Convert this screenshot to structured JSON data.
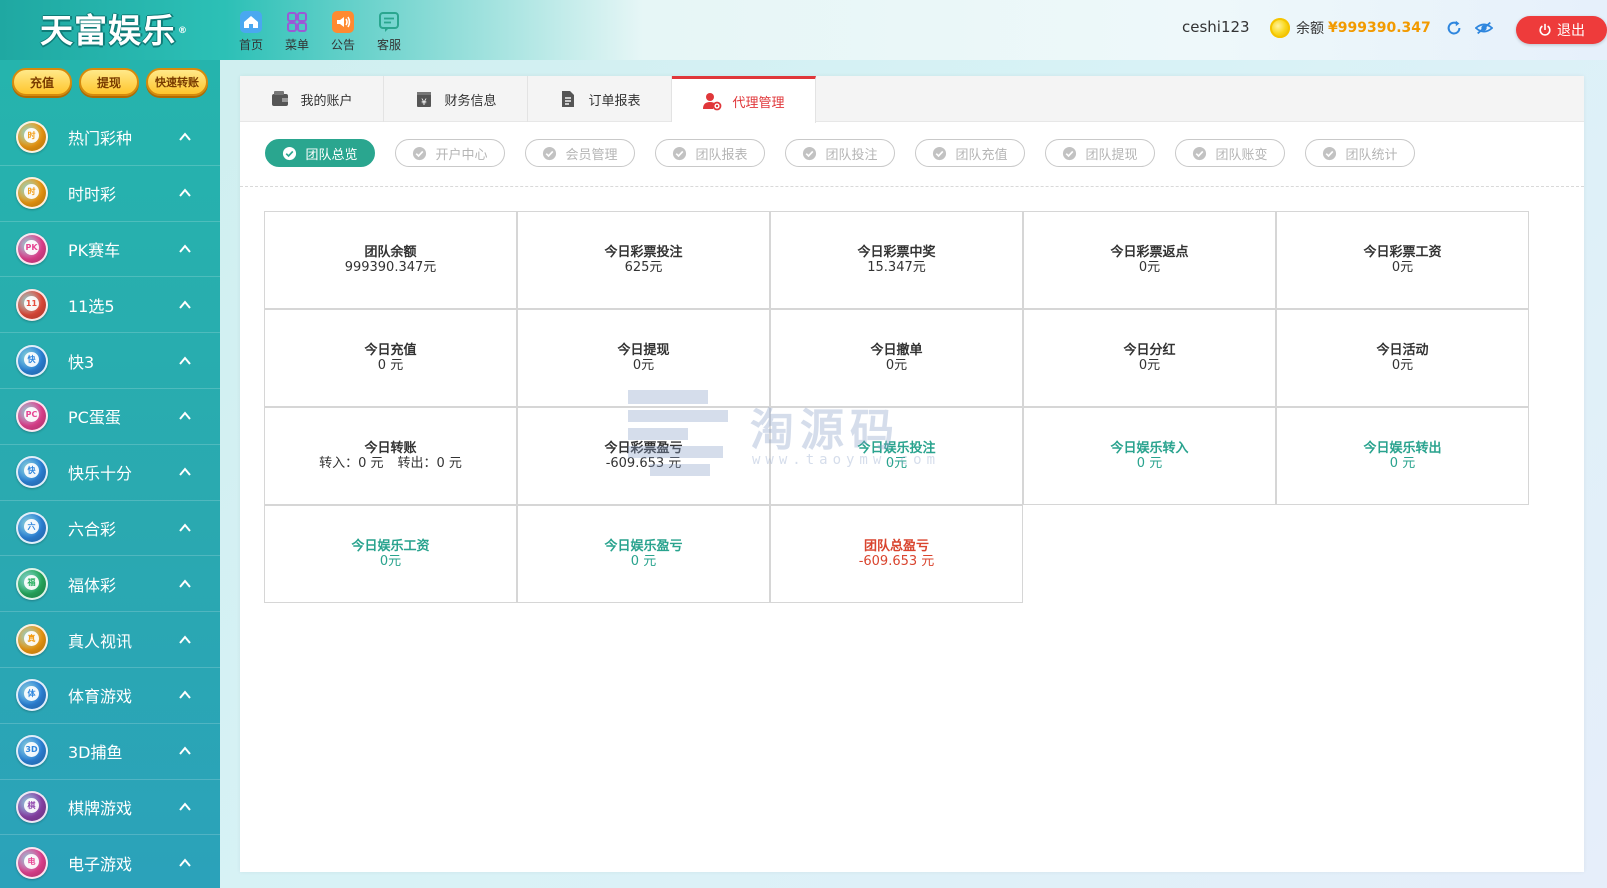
{
  "header": {
    "logo_text": "天富娱乐",
    "logo_mark": "®",
    "nav": [
      {
        "label": "首页",
        "icon": "home-icon"
      },
      {
        "label": "菜单",
        "icon": "grid-menu-icon"
      },
      {
        "label": "公告",
        "icon": "speaker-icon"
      },
      {
        "label": "客服",
        "icon": "chat-icon"
      }
    ],
    "username": "ceshi123",
    "balance_label": "余额",
    "balance_value": "¥999390.347",
    "logout_label": "退出"
  },
  "sidebar": {
    "quick_buttons": [
      "充值",
      "提现",
      "快速转账"
    ],
    "items": [
      {
        "label": "热门彩种",
        "badge": "时",
        "color": "#f39c12"
      },
      {
        "label": "时时彩",
        "badge": "时",
        "color": "#f39c12"
      },
      {
        "label": "PK赛车",
        "badge": "PK",
        "color": "#e84393"
      },
      {
        "label": "11选5",
        "badge": "11",
        "color": "#e74c3c"
      },
      {
        "label": "快3",
        "badge": "快",
        "color": "#2e86de"
      },
      {
        "label": "PC蛋蛋",
        "badge": "PC",
        "color": "#e84393"
      },
      {
        "label": "快乐十分",
        "badge": "快",
        "color": "#2e86de"
      },
      {
        "label": "六合彩",
        "badge": "六",
        "color": "#2e86de"
      },
      {
        "label": "福体彩",
        "badge": "福",
        "color": "#27ae60"
      },
      {
        "label": "真人视讯",
        "badge": "真",
        "color": "#f39c12"
      },
      {
        "label": "体育游戏",
        "badge": "体",
        "color": "#2e86de"
      },
      {
        "label": "3D捕鱼",
        "badge": "3D",
        "color": "#2e86de"
      },
      {
        "label": "棋牌游戏",
        "badge": "棋",
        "color": "#8e44ad"
      },
      {
        "label": "电子游戏",
        "badge": "电",
        "color": "#e84393"
      }
    ]
  },
  "tabs": [
    {
      "label": "我的账户",
      "icon": "wallet-icon"
    },
    {
      "label": "财务信息",
      "icon": "finance-icon"
    },
    {
      "label": "订单报表",
      "icon": "document-icon"
    },
    {
      "label": "代理管理",
      "icon": "agent-icon"
    }
  ],
  "subtabs": [
    "团队总览",
    "开户中心",
    "会员管理",
    "团队报表",
    "团队投注",
    "团队充值",
    "团队提现",
    "团队账变",
    "团队统计"
  ],
  "stats": {
    "r0": [
      {
        "title": "团队余额",
        "value": "999390.347元"
      },
      {
        "title": "今日彩票投注",
        "value": "625元"
      },
      {
        "title": "今日彩票中奖",
        "value": "15.347元"
      },
      {
        "title": "今日彩票返点",
        "value": "0元"
      },
      {
        "title": "今日彩票工资",
        "value": "0元"
      }
    ],
    "r1": [
      {
        "title": "今日充值",
        "value": "0 元"
      },
      {
        "title": "今日提现",
        "value": "0元"
      },
      {
        "title": "今日撤单",
        "value": "0元"
      },
      {
        "title": "今日分红",
        "value": "0元"
      },
      {
        "title": "今日活动",
        "value": "0元"
      }
    ],
    "r2": [
      {
        "title": "今日转账",
        "in": "转入：0 元",
        "out": "转出：0 元"
      },
      {
        "title": "今日彩票盈亏",
        "value": "-609.653 元"
      },
      {
        "title": "今日娱乐投注",
        "value": "0元"
      },
      {
        "title": "今日娱乐转入",
        "value": "0 元"
      },
      {
        "title": "今日娱乐转出",
        "value": "0 元"
      }
    ],
    "r3": [
      {
        "title": "今日娱乐工资",
        "value": "0元"
      },
      {
        "title": "今日娱乐盈亏",
        "value": "0 元"
      },
      {
        "title": "团队总盈亏",
        "value": "-609.653 元"
      }
    ]
  },
  "watermark": {
    "main": "淘源码",
    "sub": "www.taoymw.com"
  },
  "colors": {
    "accent_teal": "#2aa68f",
    "active_red": "#e0373a",
    "balance_orange": "#f29a00",
    "logout_red": "#ee3b3b"
  }
}
